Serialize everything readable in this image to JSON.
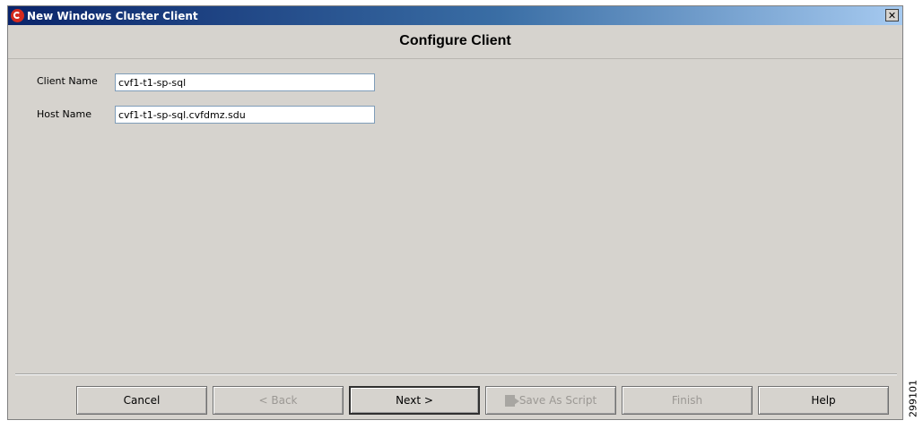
{
  "window": {
    "title": "New Windows Cluster Client",
    "close_symbol": "✕"
  },
  "heading": "Configure Client",
  "form": {
    "client_name": {
      "label": "Client Name",
      "value": "cvf1-t1-sp-sql"
    },
    "host_name": {
      "label": "Host Name",
      "value": "cvf1-t1-sp-sql.cvfdmz.sdu"
    }
  },
  "buttons": {
    "cancel": "Cancel",
    "back": "< Back",
    "next": "Next >",
    "save_as_script": "Save As Script",
    "finish": "Finish",
    "help": "Help"
  },
  "figure_id": "299101"
}
